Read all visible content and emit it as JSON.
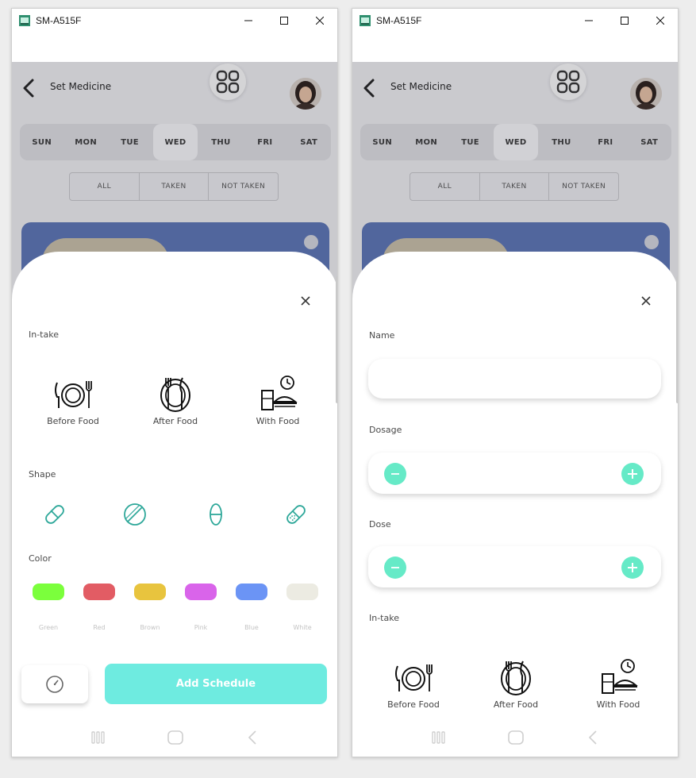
{
  "window": {
    "title": "SM-A515F",
    "minimize": "—",
    "maximize": "☐",
    "close": "✕"
  },
  "header": {
    "title": "Set Medicine"
  },
  "days": [
    "SUN",
    "MON",
    "TUE",
    "WED",
    "THU",
    "FRI",
    "SAT"
  ],
  "selected_day": "WED",
  "filter": [
    "ALL",
    "TAKEN",
    "NOT TAKEN"
  ],
  "left_sheet": {
    "intake_label": "In-take",
    "intake_options": [
      "Before Food",
      "After Food",
      "With Food"
    ],
    "shape_label": "Shape",
    "shapes": [
      "capsule",
      "tablet-round",
      "capsule-vertical",
      "capsule-dotted"
    ],
    "color_label": "Color",
    "colors": [
      {
        "name": "Green",
        "hex": "#7bff3c"
      },
      {
        "name": "Red",
        "hex": "#e25c64"
      },
      {
        "name": "Brown",
        "hex": "#e8c43e"
      },
      {
        "name": "Pink",
        "hex": "#d964ea"
      },
      {
        "name": "Blue",
        "hex": "#6b94f5"
      },
      {
        "name": "White",
        "hex": "#ecebe2"
      }
    ],
    "add_button": "Add Schedule"
  },
  "right_sheet": {
    "name_label": "Name",
    "name_value": "",
    "dosage_label": "Dosage",
    "dose_label": "Dose",
    "intake_label": "In-take",
    "intake_options": [
      "Before Food",
      "After Food",
      "With Food"
    ]
  },
  "accent_color": "#6eebe0",
  "stepper_color": "#66eac7"
}
